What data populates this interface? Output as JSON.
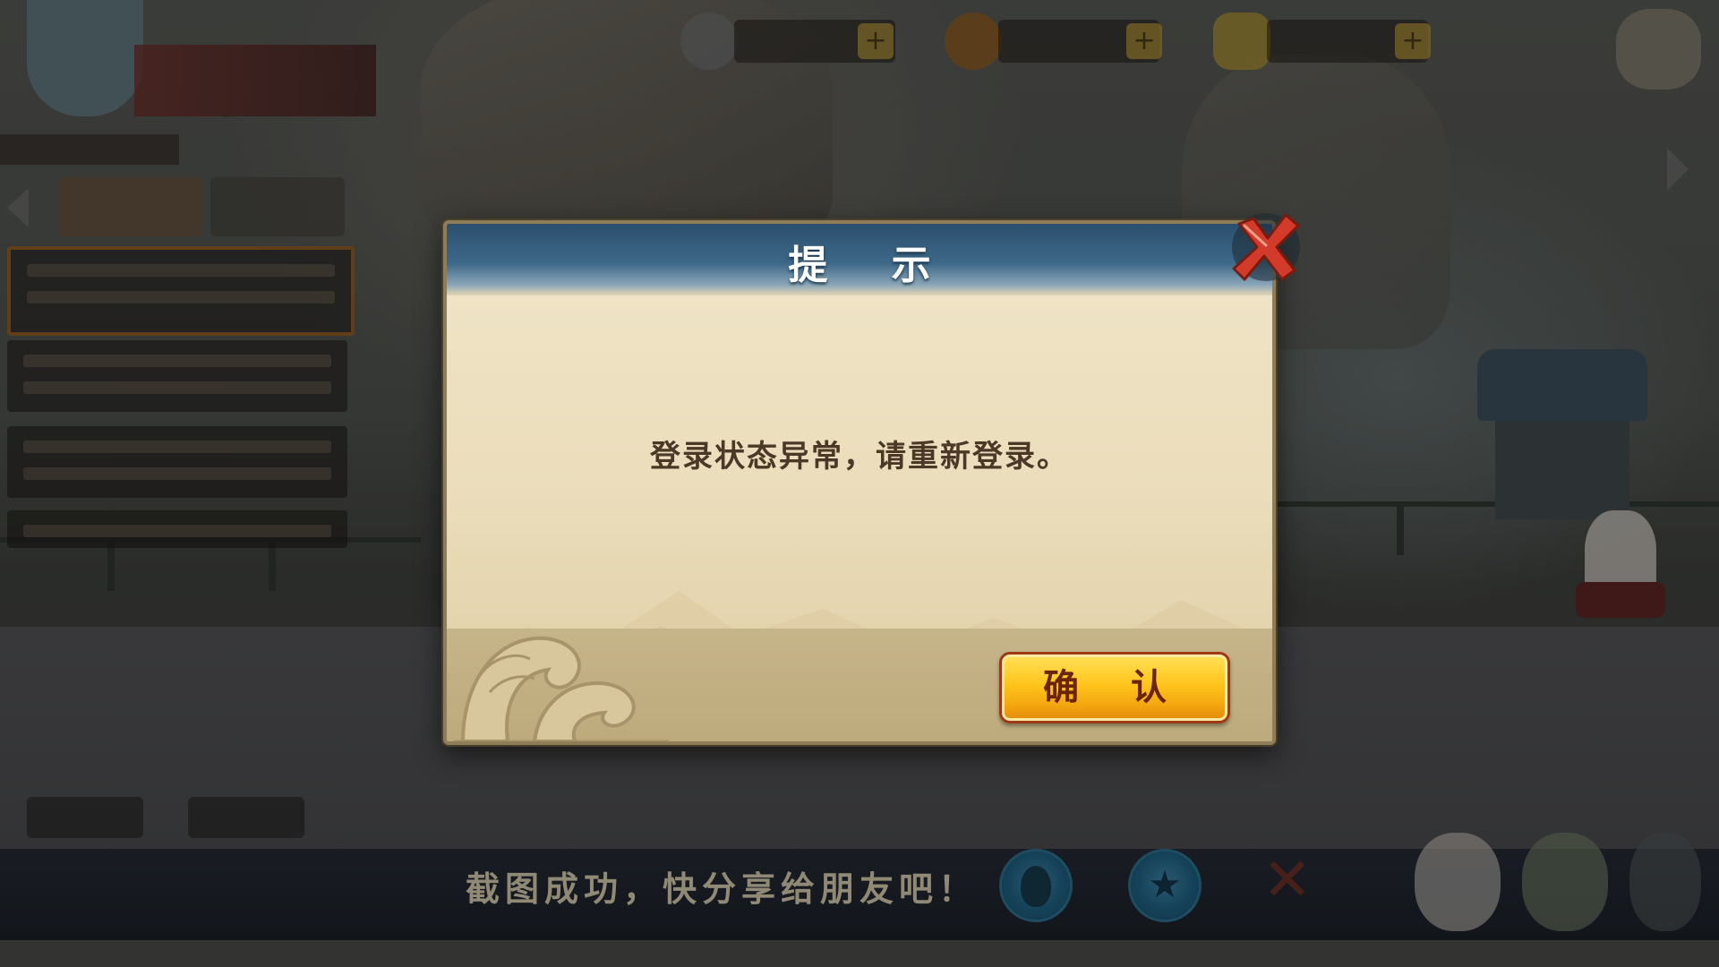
{
  "dialog": {
    "title": "提 示",
    "message": "登录状态异常，请重新登录。",
    "confirm_label": "确 认",
    "close_icon": "close-x-icon"
  },
  "share_bar": {
    "text": "截图成功，快分享给朋友吧！",
    "qq_icon": "qq-penguin-icon",
    "qzone_icon": "qzone-star-icon"
  },
  "colors": {
    "dialog_header": "#3d6888",
    "dialog_body": "#ebddbb",
    "dialog_footer": "#bdaa7c",
    "confirm_button": "#ffc51c",
    "close_x": "#d23a2a",
    "share_bar": "#1f242c",
    "share_text": "#cfc4a8"
  }
}
